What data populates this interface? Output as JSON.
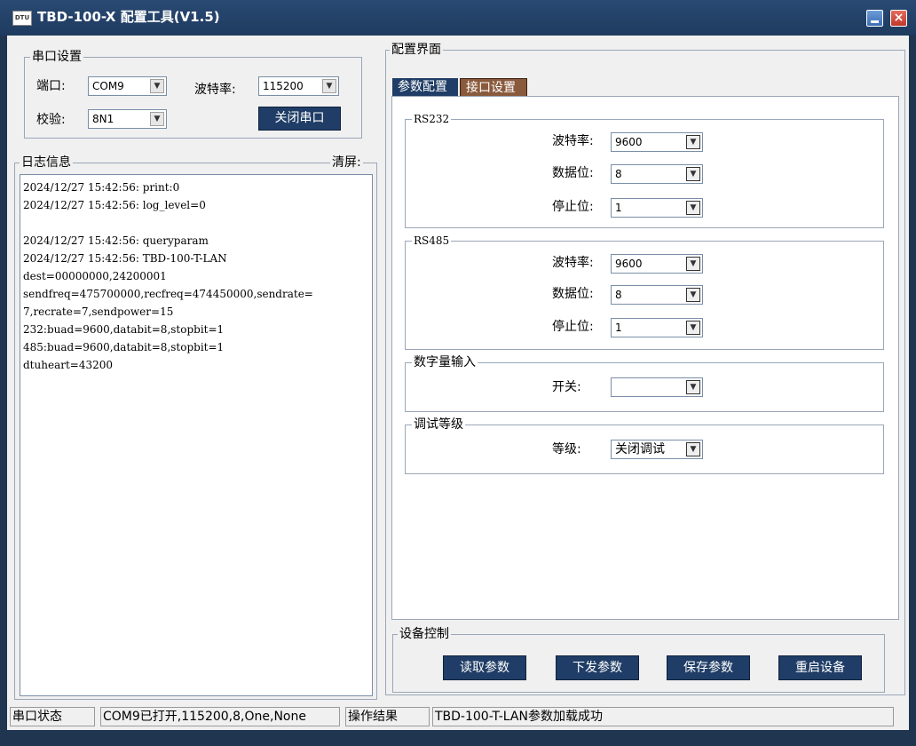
{
  "window": {
    "icon_text": "DTU",
    "title": "TBD-100-X 配置工具(V1.5)",
    "minimize": "",
    "close": "×"
  },
  "serial": {
    "group_label": "串口设置",
    "port_label": "端口:",
    "port_value": "COM9",
    "baud_label": "波特率:",
    "baud_value": "115200",
    "check_label": "校验:",
    "check_value": "8N1",
    "close_port_button": "关闭串口"
  },
  "log": {
    "group_label": "日志信息",
    "clear_label": "清屏:",
    "lines": [
      "2024/12/27 15:42:56: print:0",
      "2024/12/27 15:42:56: log_level=0",
      "",
      "2024/12/27 15:42:56: queryparam",
      "2024/12/27 15:42:56: TBD-100-T-LAN",
      "dest=00000000,24200001",
      "sendfreq=475700000,recfreq=474450000,sendrate=",
      "7,recrate=7,sendpower=15",
      "232:buad=9600,databit=8,stopbit=1",
      "485:buad=9600,databit=8,stopbit=1",
      "dtuheart=43200"
    ]
  },
  "config": {
    "group_label": "配置界面",
    "tabs": [
      "参数配置",
      "接口设置"
    ],
    "rs232": {
      "label": "RS232",
      "baud_label": "波特率:",
      "baud_value": "9600",
      "databit_label": "数据位:",
      "databit_value": "8",
      "stopbit_label": "停止位:",
      "stopbit_value": "1"
    },
    "rs485": {
      "label": "RS485",
      "baud_label": "波特率:",
      "baud_value": "9600",
      "databit_label": "数据位:",
      "databit_value": "8",
      "stopbit_label": "停止位:",
      "stopbit_value": "1"
    },
    "digital": {
      "label": "数字量输入",
      "switch_label": "开关:",
      "switch_value": ""
    },
    "debug": {
      "label": "调试等级",
      "level_label": "等级:",
      "level_value": "关闭调试"
    }
  },
  "device": {
    "group_label": "设备控制",
    "read_button": "读取参数",
    "send_button": "下发参数",
    "save_button": "保存参数",
    "restart_button": "重启设备"
  },
  "status": {
    "port_status_label": "串口状态",
    "port_status_value": "COM9已打开,115200,8,One,None",
    "result_label": "操作结果",
    "result_value": "TBD-100-T-LAN参数加载成功"
  },
  "icons": {
    "dropdown": "▼"
  }
}
